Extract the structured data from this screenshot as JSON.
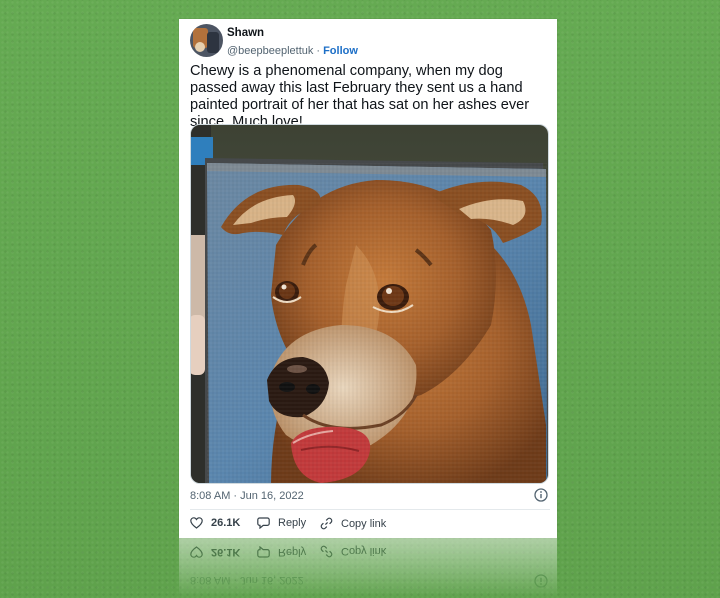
{
  "tweet": {
    "display_name": "Shawn",
    "handle": "@beepbeeplettuk",
    "separator": "·",
    "follow_label": "Follow",
    "text": "Chewy is a phenomenal company, when my dog passed away this last February they sent us a hand painted portrait of her that has sat on her ashes ever since. Much love!",
    "timestamp": "8:08 AM · Jun 16, 2022",
    "likes": "26.1K",
    "reply_label": "Reply",
    "copy_link_label": "Copy link"
  },
  "icons": {
    "like": "heart-icon",
    "reply": "speech-bubble-icon",
    "copy": "link-icon",
    "info": "info-circle-icon"
  },
  "colors": {
    "background": "#62a64f",
    "card": "#ffffff",
    "follow": "#1d6fc7",
    "text": "#0f1419",
    "muted": "#536471"
  }
}
